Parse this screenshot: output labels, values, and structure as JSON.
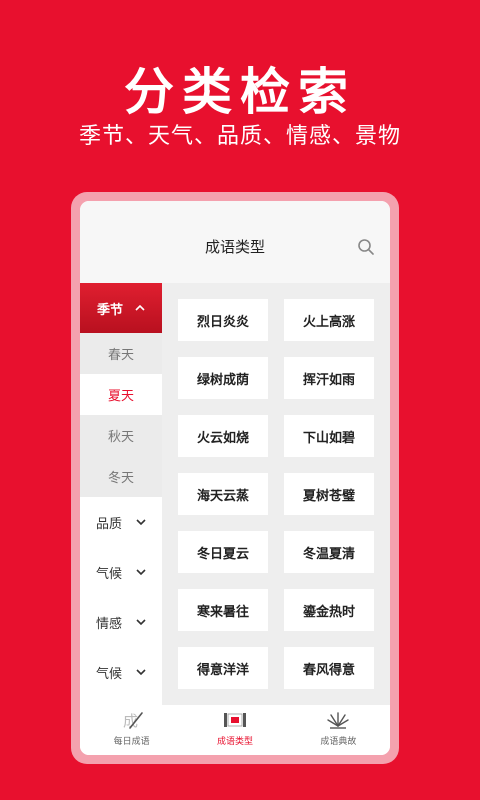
{
  "hero": {
    "title": "分类检索",
    "subtitle": "季节、天气、品质、情感、景物"
  },
  "app": {
    "header_title": "成语类型",
    "search_icon": "search-icon",
    "sidebar": {
      "group": {
        "label": "季节",
        "icon": "chevron-up-icon"
      },
      "sub_items": [
        {
          "label": "春天",
          "active": false
        },
        {
          "label": "夏天",
          "active": true
        },
        {
          "label": "秋天",
          "active": false
        },
        {
          "label": "冬天",
          "active": false
        }
      ],
      "categories": [
        {
          "label": "品质",
          "icon": "chevron-down-icon"
        },
        {
          "label": "气候",
          "icon": "chevron-down-icon"
        },
        {
          "label": "情感",
          "icon": "chevron-down-icon"
        },
        {
          "label": "气候",
          "icon": "chevron-down-icon"
        }
      ]
    },
    "idioms": [
      "烈日炎炎",
      "火上高涨",
      "绿树成荫",
      "挥汗如雨",
      "火云如烧",
      "下山如碧",
      "海天云蒸",
      "夏树苍璧",
      "冬日夏云",
      "冬温夏清",
      "寒来暑往",
      "鎏金热时",
      "得意洋洋",
      "春风得意"
    ],
    "tabs": [
      {
        "label": "每日成语",
        "icon": "brush-icon",
        "active": false
      },
      {
        "label": "成语类型",
        "icon": "scroll-icon",
        "active": true
      },
      {
        "label": "成语典故",
        "icon": "fan-icon",
        "active": false
      }
    ]
  },
  "colors": {
    "brand_red": "#E8102E",
    "frame_pink": "#F4A1AE"
  }
}
